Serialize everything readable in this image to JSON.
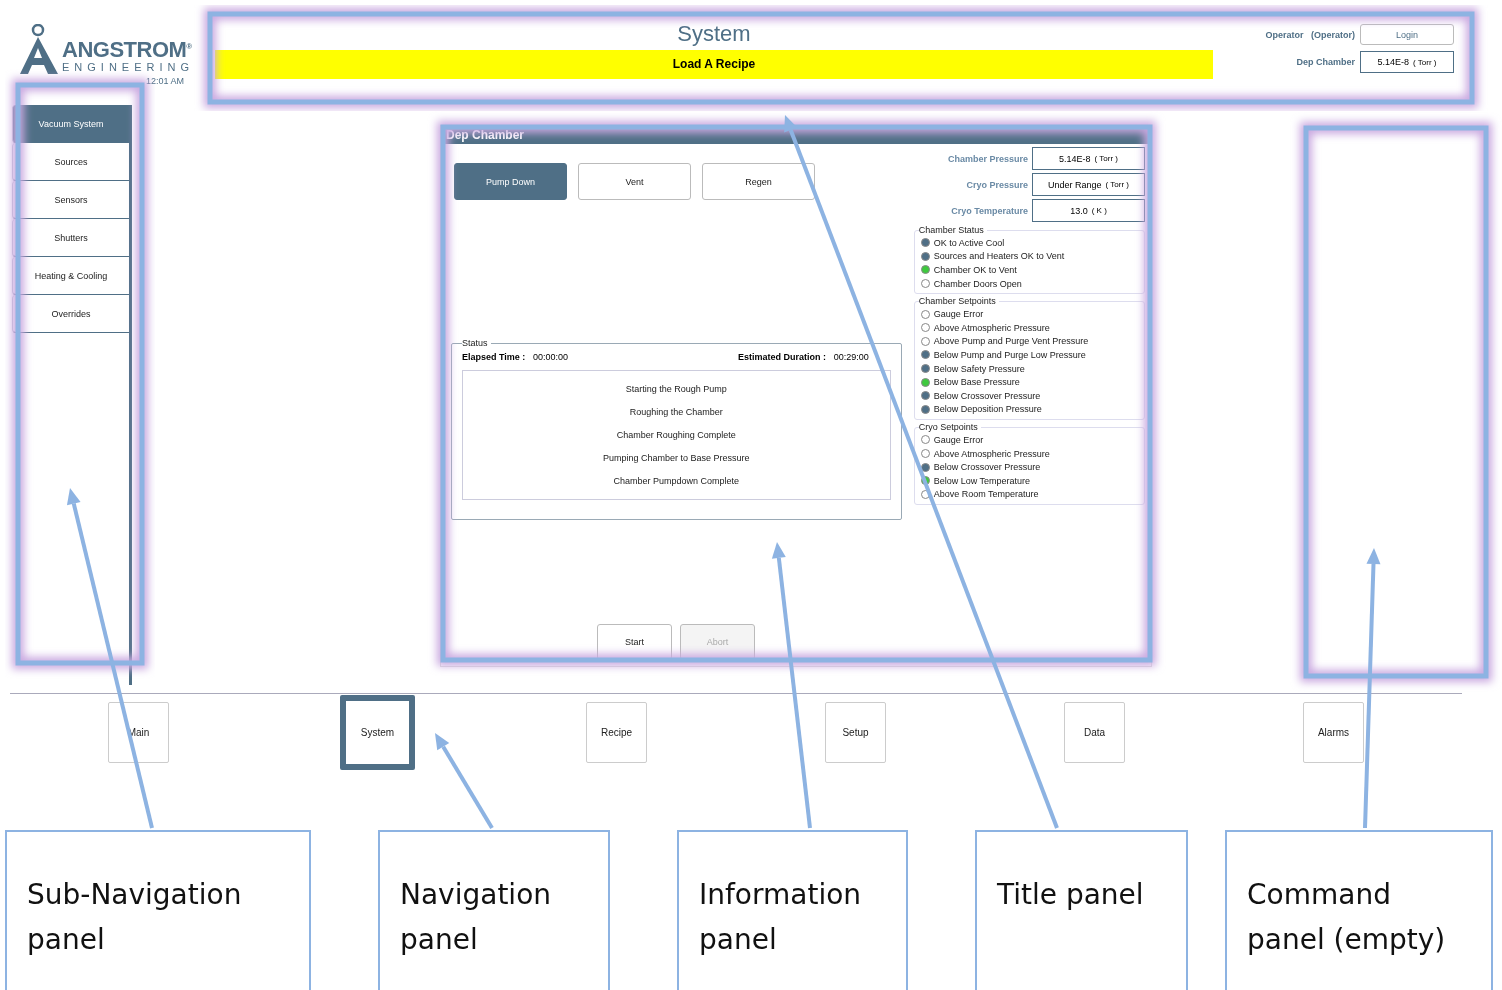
{
  "header": {
    "logo": {
      "name": "ANGSTROM",
      "mark": "®",
      "sub": "ENGINEERING"
    },
    "datetime": "12:01 AM",
    "title": "System",
    "banner": "Load A Recipe",
    "operator_label": "Operator",
    "operator_value": "(Operator)",
    "login_button": "Login",
    "chamber_label": "Dep Chamber",
    "chamber_value": "5.14E-8",
    "chamber_unit": "( Torr )"
  },
  "sidebar": {
    "items": [
      {
        "label": "Vacuum System",
        "selected": true
      },
      {
        "label": "Sources",
        "selected": false
      },
      {
        "label": "Sensors",
        "selected": false
      },
      {
        "label": "Shutters",
        "selected": false
      },
      {
        "label": "Heating & Cooling",
        "selected": false
      },
      {
        "label": "Overrides",
        "selected": false
      }
    ]
  },
  "info_panel": {
    "title": "Dep Chamber",
    "mode_buttons": [
      {
        "label": "Pump Down",
        "selected": true
      },
      {
        "label": "Vent",
        "selected": false
      },
      {
        "label": "Regen",
        "selected": false
      }
    ],
    "readouts": [
      {
        "label": "Chamber Pressure",
        "value": "5.14E-8",
        "unit": "( Torr )"
      },
      {
        "label": "Cryo Pressure",
        "value": "Under Range",
        "unit": "( Torr )"
      },
      {
        "label": "Cryo Temperature",
        "value": "13.0",
        "unit": "( K )"
      }
    ],
    "groups": [
      {
        "title": "Chamber Status",
        "items": [
          {
            "label": "OK to Active Cool",
            "on": true,
            "color": "#4f6f86"
          },
          {
            "label": "Sources and Heaters OK to Vent",
            "on": true,
            "color": "#4f6f86"
          },
          {
            "label": "Chamber OK to Vent",
            "on": true,
            "color": "#3ec93e"
          },
          {
            "label": "Chamber Doors Open",
            "on": false
          }
        ]
      },
      {
        "title": "Chamber Setpoints",
        "items": [
          {
            "label": "Gauge Error",
            "on": false
          },
          {
            "label": "Above Atmospheric Pressure",
            "on": false
          },
          {
            "label": "Above Pump and Purge Vent Pressure",
            "on": false
          },
          {
            "label": "Below Pump and Purge Low Pressure",
            "on": true,
            "color": "#4f6f86"
          },
          {
            "label": "Below Safety Pressure",
            "on": true,
            "color": "#4f6f86"
          },
          {
            "label": "Below Base Pressure",
            "on": true,
            "color": "#3ec93e"
          },
          {
            "label": "Below Crossover Pressure",
            "on": true,
            "color": "#4f6f86"
          },
          {
            "label": "Below Deposition Pressure",
            "on": true,
            "color": "#4f6f86"
          }
        ]
      },
      {
        "title": "Cryo Setpoints",
        "items": [
          {
            "label": "Gauge Error",
            "on": false
          },
          {
            "label": "Above Atmospheric Pressure",
            "on": false
          },
          {
            "label": "Below Crossover Pressure",
            "on": true,
            "color": "#4f6f86"
          },
          {
            "label": "Below Low Temperature",
            "on": true,
            "color": "#3ec93e"
          },
          {
            "label": "Above Room Temperature",
            "on": false
          }
        ]
      }
    ],
    "status": {
      "title": "Status",
      "elapsed_label": "Elapsed Time :",
      "elapsed_value": "00:00:00",
      "estimated_label": "Estimated Duration :",
      "estimated_value": "00:29:00",
      "steps": [
        "Starting the Rough Pump",
        "Roughing the Chamber",
        "Chamber Roughing Complete",
        "Pumping Chamber to Base Pressure",
        "Chamber Pumpdown Complete"
      ]
    },
    "action_buttons": [
      {
        "label": "Start",
        "disabled": false
      },
      {
        "label": "Abort",
        "disabled": true
      }
    ]
  },
  "navigation": [
    {
      "label": "Main",
      "selected": false
    },
    {
      "label": "System",
      "selected": true
    },
    {
      "label": "Recipe",
      "selected": false
    },
    {
      "label": "Setup",
      "selected": false
    },
    {
      "label": "Data",
      "selected": false
    },
    {
      "label": "Alarms",
      "selected": false
    }
  ],
  "annotations": [
    {
      "label": "Sub-Navigation panel",
      "kind": "sidebar"
    },
    {
      "label": "Navigation panel",
      "kind": "navigation"
    },
    {
      "label": "Information panel",
      "kind": "info"
    },
    {
      "label": "Title panel",
      "kind": "title"
    },
    {
      "label": "Command panel (empty)",
      "kind": "command"
    }
  ]
}
